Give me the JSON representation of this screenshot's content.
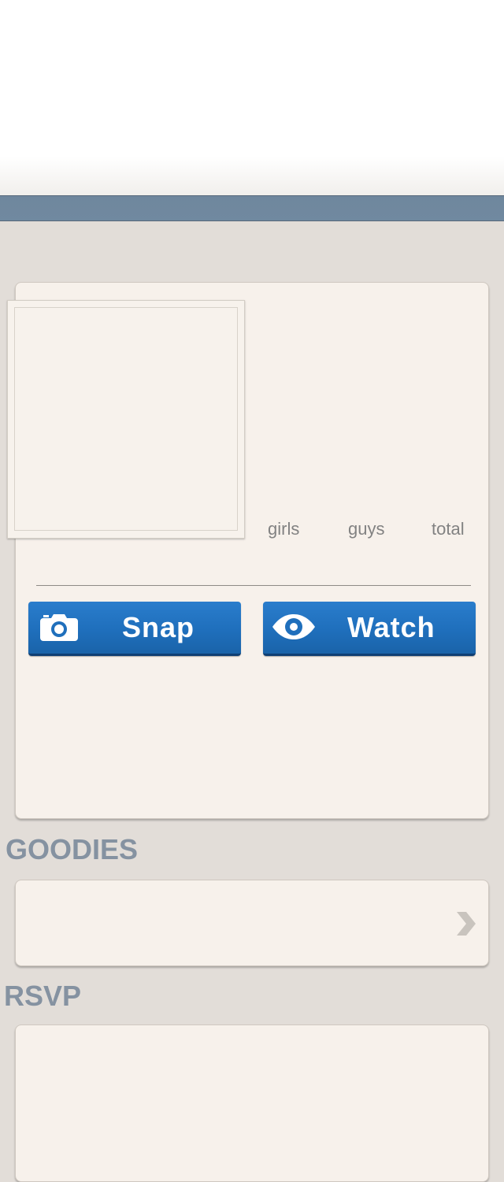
{
  "event": {
    "stats": {
      "girls_label": "girls",
      "guys_label": "guys",
      "total_label": "total"
    },
    "actions": {
      "snap_label": "Snap",
      "watch_label": "Watch",
      "snap_icon": "camera-icon",
      "watch_icon": "eye-icon"
    }
  },
  "sections": {
    "goodies_heading": "GOODIES",
    "rsvp_heading": "RSVP",
    "goodies_chevron_icon": "chevron-right-icon"
  },
  "colors": {
    "nav_bar": "#7089a0",
    "button_blue": "#1f6fbc",
    "heading_gray": "#8592a1",
    "card_bg": "#f7f1eb",
    "page_bg": "#e2ddd8"
  }
}
